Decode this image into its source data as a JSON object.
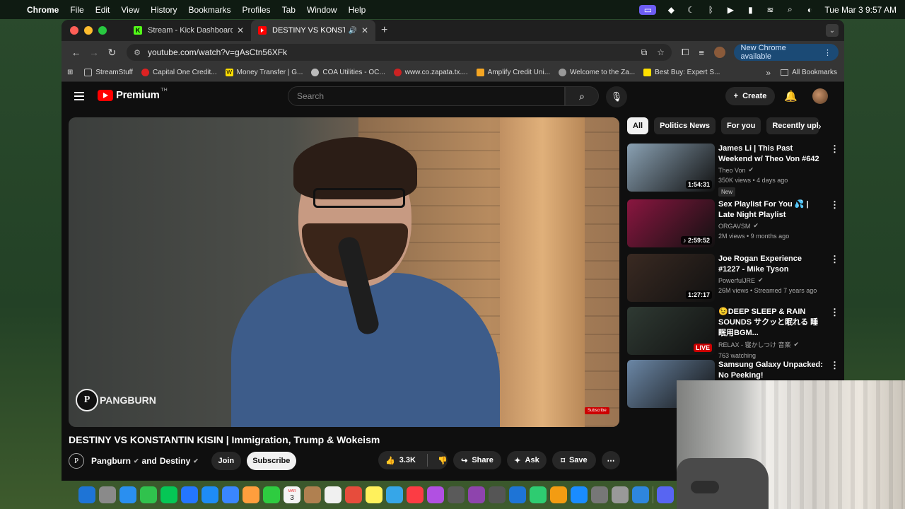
{
  "menubar": {
    "app": "Chrome",
    "items": [
      "File",
      "Edit",
      "View",
      "History",
      "Bookmarks",
      "Profiles",
      "Tab",
      "Window",
      "Help"
    ],
    "datetime": "Tue Mar 3  9:57 AM"
  },
  "tabs": [
    {
      "title": "Stream - Kick Dashboard",
      "favicon_color": "#53fc18",
      "favicon_letter": "K"
    },
    {
      "title": "DESTINY VS KONSTANTIN",
      "favicon_color": "#ff0000",
      "favicon_letter": ""
    }
  ],
  "toolbar": {
    "url": "youtube.com/watch?v=gAsCtn56XFk",
    "new_chrome": "New Chrome available"
  },
  "bookmarks": [
    {
      "label": "StreamStuff",
      "color": "#666"
    },
    {
      "label": "Capital One Credit...",
      "color": "#d22"
    },
    {
      "label": "Money Transfer | G...",
      "color": "#ffdd00"
    },
    {
      "label": "COA Utilities - OC...",
      "color": "#bbb"
    },
    {
      "label": "www.co.zapata.tx....",
      "color": "#c22"
    },
    {
      "label": "Amplify Credit Uni...",
      "color": "#f5a623"
    },
    {
      "label": "Welcome to the Za...",
      "color": "#999"
    },
    {
      "label": "Best Buy: Expert S...",
      "color": "#ffe000"
    }
  ],
  "all_bookmarks": "All Bookmarks",
  "youtube": {
    "logo_text": "Premium",
    "country": "TH",
    "search_placeholder": "Search",
    "create_label": "Create",
    "video": {
      "title": "DESTINY VS KONSTANTIN KISIN | Immigration, Trump & Wokeism",
      "watermark": "PANGBURN",
      "subscribe_badge": "Subscribe",
      "channel": "Pangburn",
      "and": "and",
      "collab": "Destiny",
      "join": "Join",
      "subscribe": "Subscribe",
      "likes": "3.3K",
      "share": "Share",
      "ask": "Ask",
      "save": "Save"
    },
    "chips": [
      "All",
      "Politics News",
      "For you",
      "Recently uploaded"
    ],
    "recommendations": [
      {
        "title": "James Li | This Past Weekend w/ Theo Von #642",
        "channel": "Theo Von",
        "stats": "350K views • 4 days ago",
        "duration": "1:54:31",
        "badge": "New",
        "thumb": "#8aa1b3",
        "verified": true,
        "live": false
      },
      {
        "title": "Sex Playlist For You 💦 | Late Night Playlist",
        "channel": "ORGAVSM",
        "stats": "2M views • 9 months ago",
        "duration": "♪ 2:59:52",
        "badge": "",
        "thumb": "#8a1640",
        "verified": true,
        "live": false
      },
      {
        "title": "Joe Rogan Experience #1227 - Mike Tyson",
        "channel": "PowerfulJRE",
        "stats": "26M views • Streamed 7 years ago",
        "duration": "1:27:17",
        "badge": "",
        "thumb": "#3a2a22",
        "verified": true,
        "live": false
      },
      {
        "title": "😉DEEP SLEEP & RAIN SOUNDS サクッと眠れる 睡眠用BGM...",
        "channel": "RELAX - 寝かしつけ 音楽",
        "stats": "763 watching",
        "duration": "LIVE",
        "badge": "",
        "thumb": "#2f3a33",
        "verified": true,
        "live": true
      },
      {
        "title": "Samsung Galaxy Unpacked: No Peeking!",
        "channel": "",
        "stats": "",
        "duration": "",
        "badge": "",
        "thumb": "#6b87a6",
        "verified": false,
        "live": false
      }
    ]
  },
  "dock_colors": [
    "#1e74d6",
    "#8a8a8a",
    "#2a8ff0",
    "#30c24d",
    "#05c755",
    "#2476ff",
    "#1e8cf5",
    "#3a86ff",
    "#ff9e3d",
    "#2ecc40",
    "#f4f4f4",
    "#b08050",
    "#f0f0f0",
    "#e74c3c",
    "#fff15c",
    "#36a6e8",
    "#fc3c44",
    "#b150e2",
    "#5a5a5a",
    "#8e44ad",
    "#555",
    "#1e74d6",
    "#2ecc71",
    "#f39c12",
    "#1a8cff",
    "#777",
    "#999",
    "#2e86de",
    "#5865f2"
  ],
  "calendar_day": "3",
  "calendar_month": "MAR"
}
